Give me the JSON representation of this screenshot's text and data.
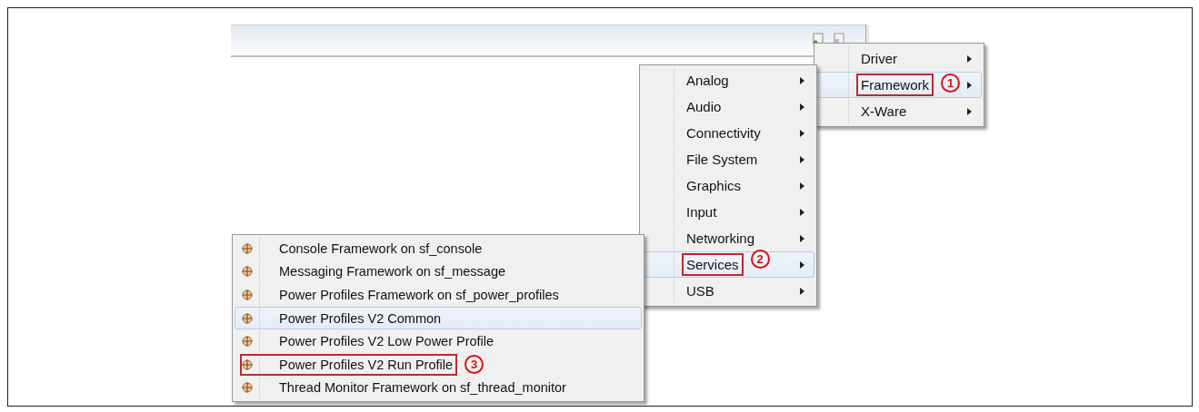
{
  "menus": [
    {
      "items": [
        {
          "label": "Driver",
          "kind": "submenu",
          "selected": false
        },
        {
          "label": "Framework",
          "kind": "submenu",
          "selected": true,
          "callout": "1"
        },
        {
          "label": "X-Ware",
          "kind": "submenu",
          "selected": false
        }
      ]
    },
    {
      "items": [
        {
          "label": "Analog",
          "kind": "submenu",
          "selected": false
        },
        {
          "label": "Audio",
          "kind": "submenu",
          "selected": false
        },
        {
          "label": "Connectivity",
          "kind": "submenu",
          "selected": false
        },
        {
          "label": "File System",
          "kind": "submenu",
          "selected": false
        },
        {
          "label": "Graphics",
          "kind": "submenu",
          "selected": false
        },
        {
          "label": "Input",
          "kind": "submenu",
          "selected": false
        },
        {
          "label": "Networking",
          "kind": "submenu",
          "selected": false
        },
        {
          "label": "Services",
          "kind": "submenu",
          "selected": true,
          "callout": "2"
        },
        {
          "label": "USB",
          "kind": "submenu",
          "selected": false
        }
      ]
    },
    {
      "items": [
        {
          "label": "Console Framework on sf_console",
          "kind": "component",
          "selected": false
        },
        {
          "label": "Messaging Framework on sf_message",
          "kind": "component",
          "selected": false
        },
        {
          "label": "Power Profiles Framework on sf_power_profiles",
          "kind": "component",
          "selected": false
        },
        {
          "label": "Power Profiles V2 Common",
          "kind": "component",
          "selected": true
        },
        {
          "label": "Power Profiles V2 Low Power Profile",
          "kind": "component",
          "selected": false
        },
        {
          "label": "Power Profiles V2 Run Profile",
          "kind": "component",
          "selected": false,
          "callout": "3"
        },
        {
          "label": "Thread Monitor Framework on sf_thread_monitor",
          "kind": "component",
          "selected": false
        }
      ]
    }
  ]
}
